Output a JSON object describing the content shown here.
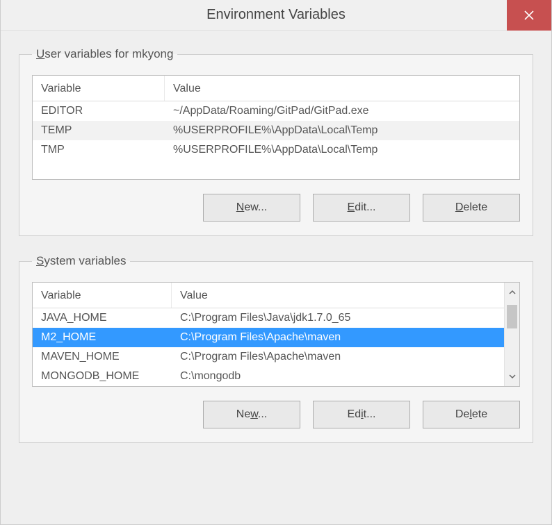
{
  "title": "Environment Variables",
  "user_group": {
    "legend_prefix": "U",
    "legend_rest": "ser variables for mkyong",
    "columns": {
      "variable": "Variable",
      "value": "Value"
    },
    "rows": [
      {
        "variable": "EDITOR",
        "value": "~/AppData/Roaming/GitPad/GitPad.exe"
      },
      {
        "variable": "TEMP",
        "value": "%USERPROFILE%\\AppData\\Local\\Temp"
      },
      {
        "variable": "TMP",
        "value": "%USERPROFILE%\\AppData\\Local\\Temp"
      }
    ],
    "buttons": {
      "new_prefix": "N",
      "new_rest": "ew...",
      "edit_prefix": "E",
      "edit_rest": "dit...",
      "delete_prefix": "D",
      "delete_rest": "elete"
    }
  },
  "system_group": {
    "legend_prefix": "S",
    "legend_rest": "ystem variables",
    "columns": {
      "variable": "Variable",
      "value": "Value"
    },
    "rows": [
      {
        "variable": "JAVA_HOME",
        "value": "C:\\Program Files\\Java\\jdk1.7.0_65",
        "selected": false
      },
      {
        "variable": "M2_HOME",
        "value": "C:\\Program Files\\Apache\\maven",
        "selected": true
      },
      {
        "variable": "MAVEN_HOME",
        "value": "C:\\Program Files\\Apache\\maven",
        "selected": false
      },
      {
        "variable": "MONGODB_HOME",
        "value": "C:\\mongodb",
        "selected": false
      }
    ],
    "buttons": {
      "new_prefix": "w",
      "new_label_before": "Ne",
      "new_label_after": "...",
      "edit_prefix": "i",
      "edit_label_before": "Ed",
      "edit_label_after": "t...",
      "delete_prefix": "l",
      "delete_label_before": "De",
      "delete_label_after": "ete"
    }
  }
}
